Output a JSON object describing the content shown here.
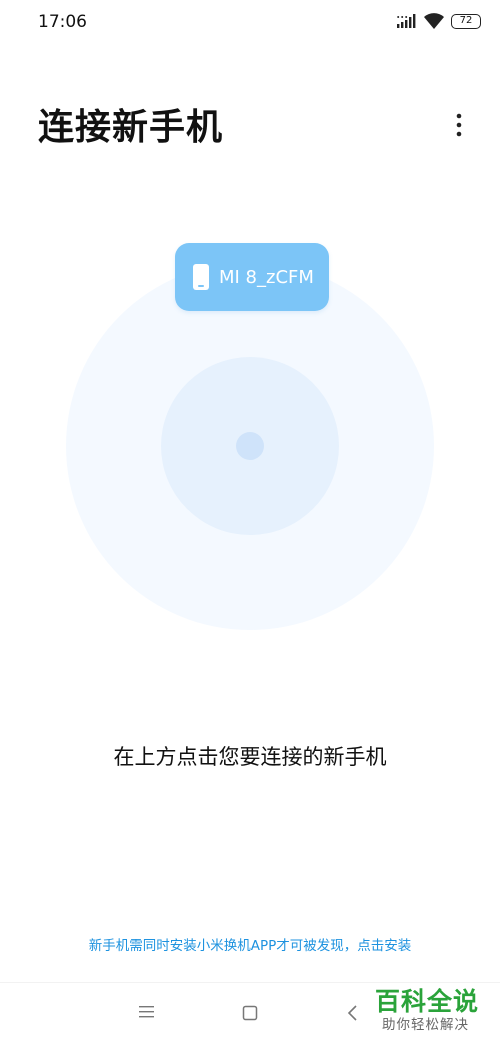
{
  "status_bar": {
    "time": "17:06",
    "battery": "72"
  },
  "header": {
    "title": "连接新手机",
    "more_icon": "more-vertical-icon"
  },
  "radar": {
    "device_name": "MI 8_zCFM",
    "device_icon": "phone-icon",
    "colors": {
      "outer_circle": "#f4f9ff",
      "inner_circle": "#e6f1fd",
      "center_dot": "#cfe3fa",
      "device_chip": "#7cc5f7"
    }
  },
  "main": {
    "hint": "在上方点击您要连接的新手机",
    "install_link": "新手机需同时安装小米换机APP才可被发现，点击安装",
    "link_color": "#1d92df"
  },
  "nav_bar": {
    "icons": [
      "menu-icon",
      "home-icon",
      "back-icon"
    ]
  },
  "watermark": {
    "main": "百科全说",
    "sub": "助你轻松解决"
  }
}
